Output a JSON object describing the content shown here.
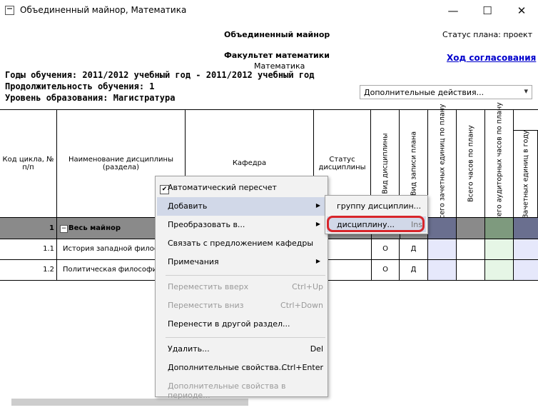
{
  "window": {
    "title": "Объединенный майнор, Математика",
    "minimize_glyph": "—",
    "maximize_glyph": "☐",
    "close_glyph": "✕"
  },
  "header": {
    "title": "Объединенный майнор",
    "faculty": "Факультет математики",
    "subject": "Математика",
    "years": "Годы обучения: 2011/2012 учебный год - 2011/2012 учебный год",
    "duration": "Продолжительность обучения: 1",
    "level": "Уровень образования: Магистратура",
    "plan_status": "Статус плана: проект",
    "approval_link": "Ход согласования"
  },
  "actions_select": {
    "value": "Дополнительные действия..."
  },
  "table": {
    "headers": {
      "code": "Код цикла, № п/п",
      "name": "Наименование дисциплины (раздела)",
      "department": "Кафедра",
      "status": "Статус дисциплины",
      "kind": "Вид дисциплины",
      "record": "Вид записи плана",
      "credits_total": "Всего зачетных единиц по плану",
      "hours_total": "Всего часов по плану",
      "classroom_hours": "Всего аудиторных часов по плану",
      "credits_year": "Зачетных единиц в году"
    },
    "rows": [
      {
        "code": "1",
        "name": "Весь майнор",
        "kind": "",
        "record": ""
      },
      {
        "code": "1.1",
        "name": "История западной филосо",
        "kind": "О",
        "record": "Д"
      },
      {
        "code": "1.2",
        "name": "Политическая философи",
        "kind": "О",
        "record": "Д"
      }
    ],
    "group_toggle": "−"
  },
  "context_menu": {
    "auto_recalc": "Автоматический пересчет",
    "add": "Добавить",
    "convert": "Преобразовать в...",
    "link_dept": "Связать с предложением кафедры",
    "notes": "Примечания",
    "move_up": "Переместить вверх",
    "move_up_sc": "Ctrl+Up",
    "move_down": "Переместить вниз",
    "move_down_sc": "Ctrl+Down",
    "move_section": "Перенести в другой раздел...",
    "delete": "Удалить...",
    "delete_sc": "Del",
    "props": "Дополнительные свойства...",
    "props_sc": "Ctrl+Enter",
    "props_period": "Дополнительные свойства в периоде...",
    "arrow": "▶",
    "check": "✔"
  },
  "submenu": {
    "group": "группу дисциплин...",
    "discipline": "дисциплину...",
    "discipline_sc": "Ins"
  },
  "colors": {
    "highlight": "#d8262b",
    "group_row": "#8a8a8a",
    "menu_selected": "#d1d8e8"
  }
}
